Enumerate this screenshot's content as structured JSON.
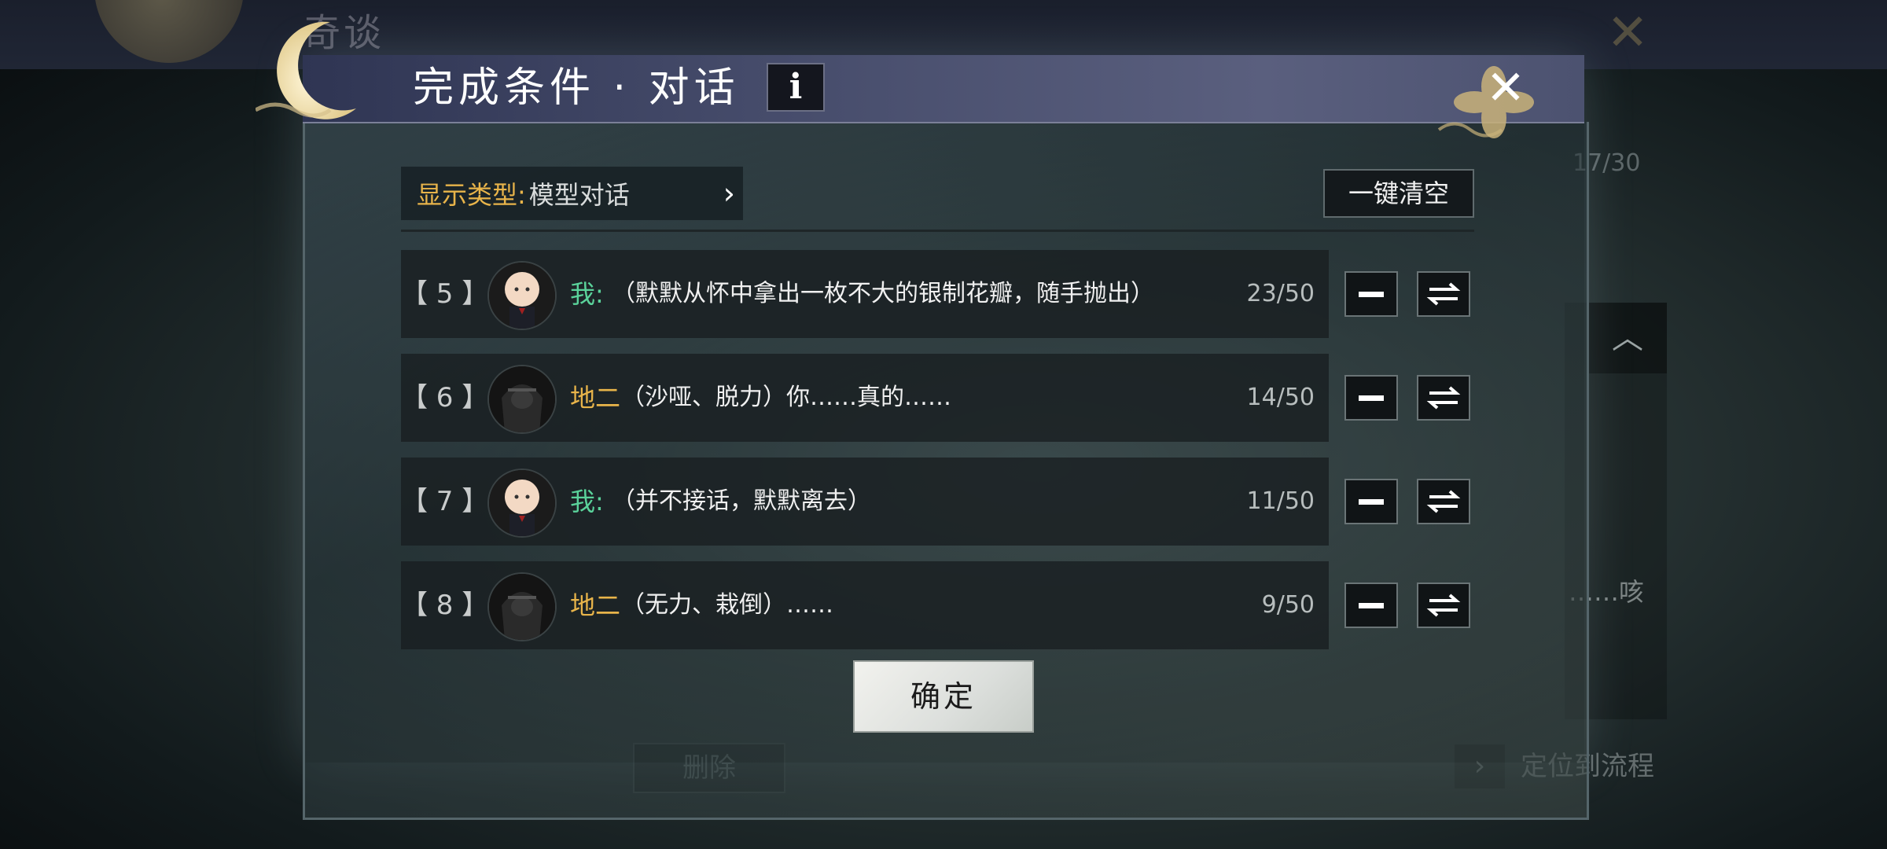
{
  "background": {
    "title": "奇谈",
    "count": "17/30",
    "ghost_text": "……咳",
    "delete_label": "删除",
    "locate_label": "定位到流程"
  },
  "dialog": {
    "title": "完成条件 · 对话",
    "info_icon": "info-icon",
    "close_icon": "close-icon",
    "display_type_label": "显示类型:",
    "display_type_value": "模型对话",
    "clear_all_label": "一键清空",
    "confirm_label": "确定",
    "rows": [
      {
        "index": "【 5 】",
        "speaker": "我:",
        "speaker_kind": "player",
        "text": "（默默从怀中拿出一枚不大的银制花瓣，随手抛出）",
        "count": "23/50"
      },
      {
        "index": "【 6 】",
        "speaker": "地二",
        "speaker_kind": "npc",
        "text": "（沙哑、脱力）你……真的……",
        "count": "14/50"
      },
      {
        "index": "【 7 】",
        "speaker": "我:",
        "speaker_kind": "player",
        "text": "（并不接话，默默离去）",
        "count": "11/50"
      },
      {
        "index": "【 8 】",
        "speaker": "地二",
        "speaker_kind": "npc",
        "text": "（无力、栽倒）……",
        "count": "9/50"
      }
    ],
    "row_actions": {
      "remove_icon": "minus-icon",
      "swap_icon": "swap-arrows-icon"
    }
  },
  "colors": {
    "label_gold": "#e8b44a",
    "player_green": "#5ad29a",
    "header_purple": "#454b6a"
  }
}
